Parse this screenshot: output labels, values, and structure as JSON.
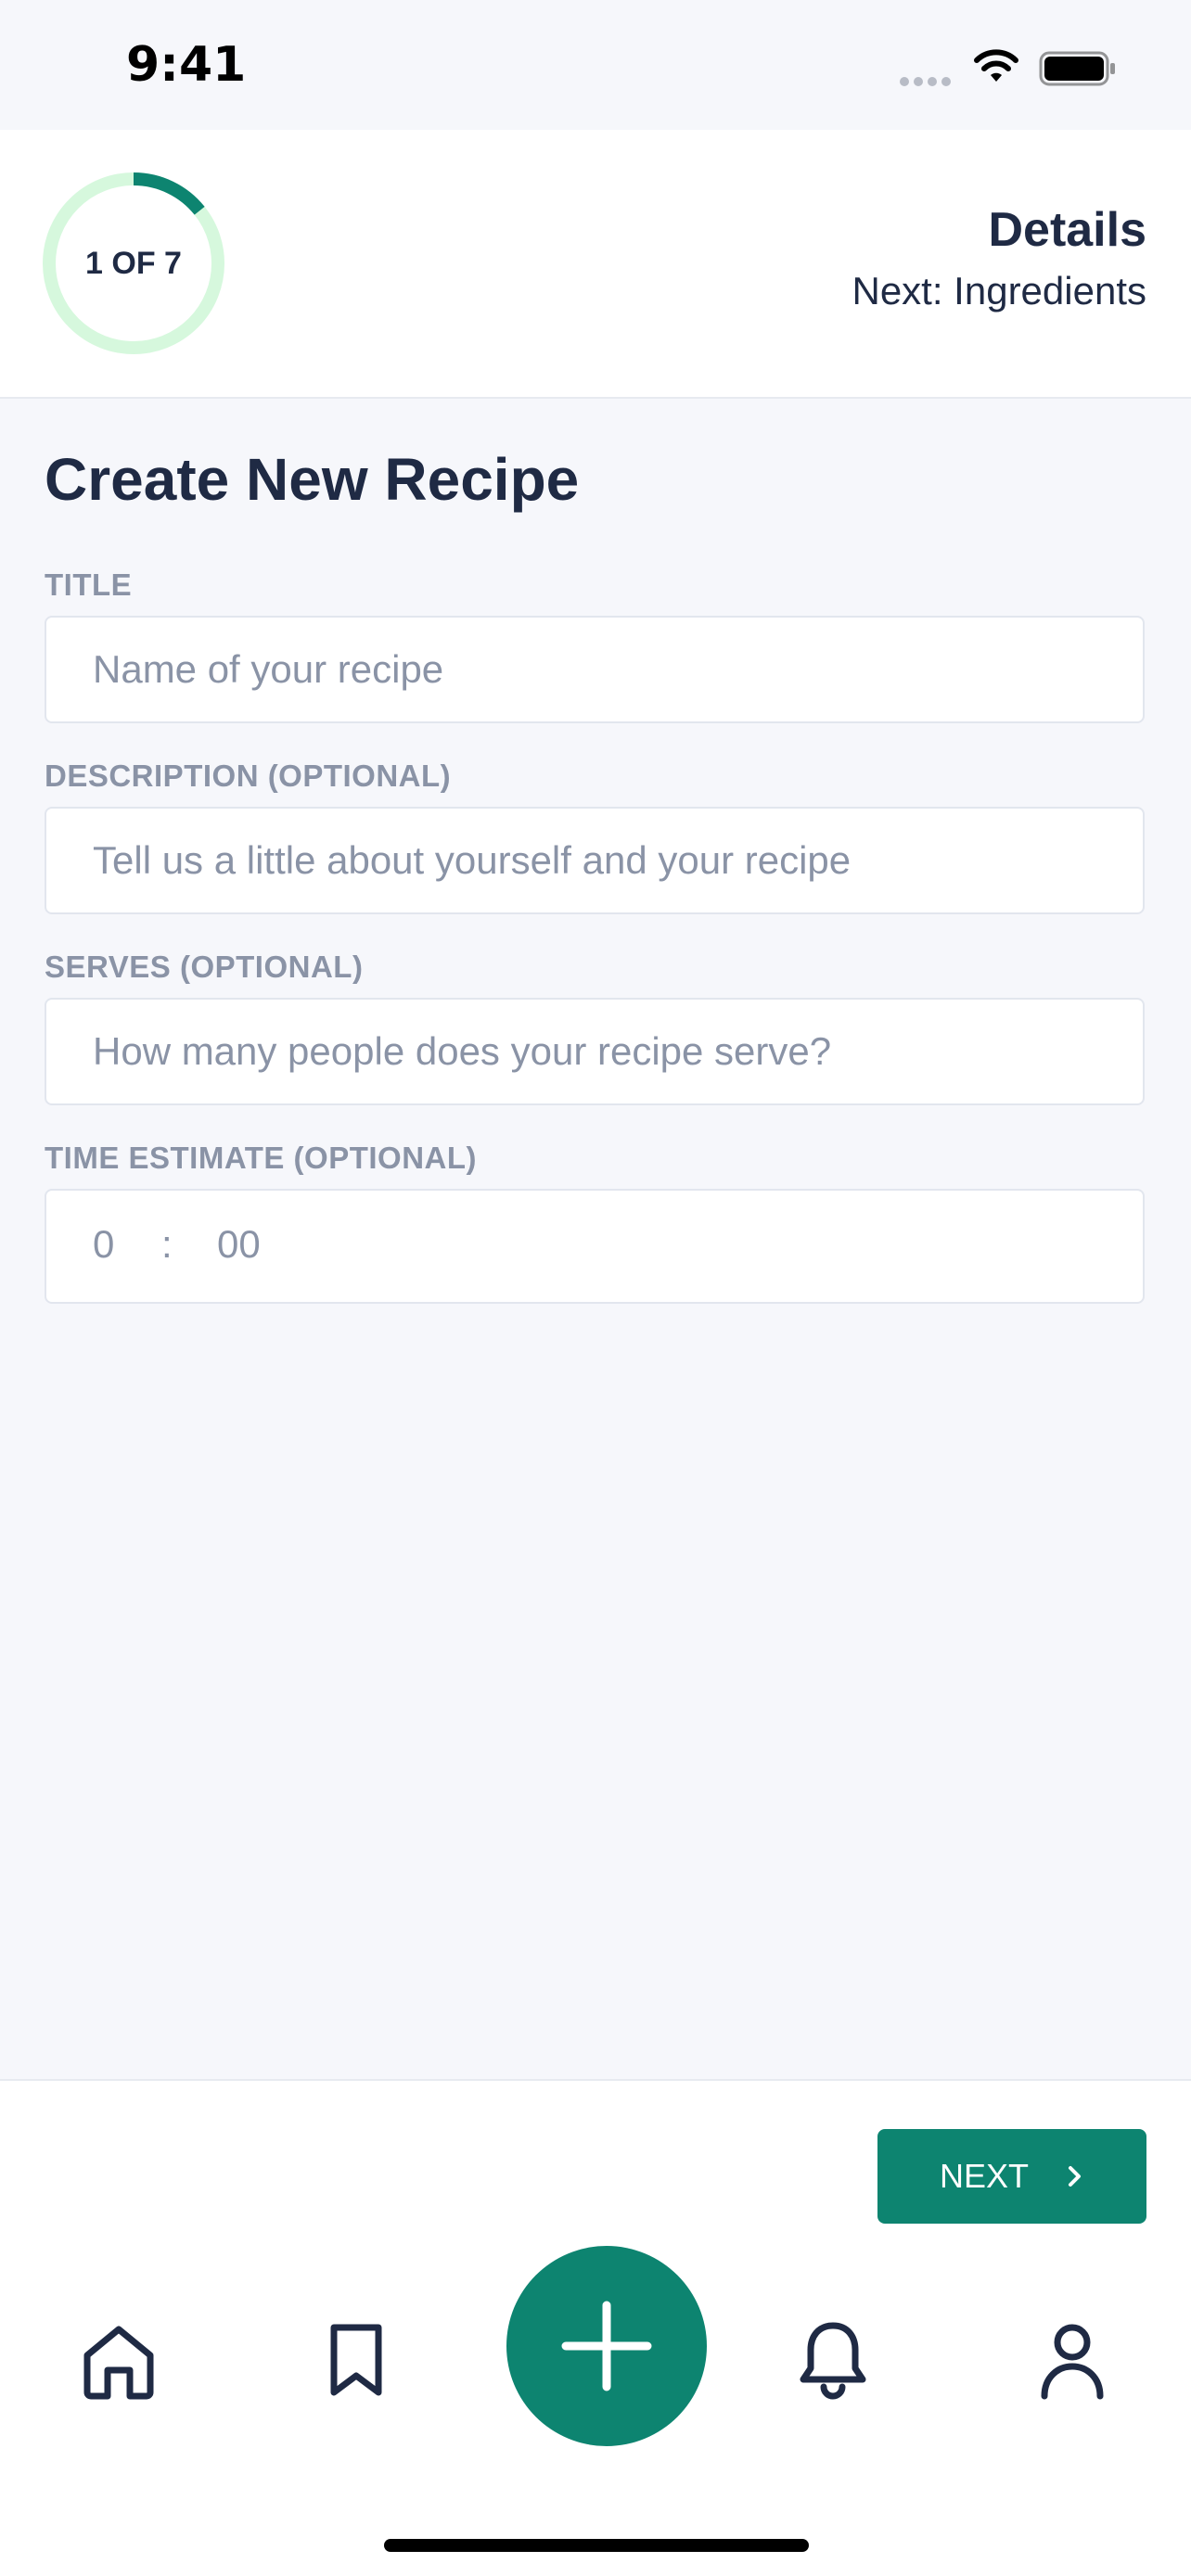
{
  "status_bar": {
    "time": "9:41",
    "icons": [
      "signal-icon",
      "wifi-icon",
      "battery-icon"
    ]
  },
  "header": {
    "progress_label": "1 OF 7",
    "progress": {
      "current": 1,
      "total": 7
    },
    "step_title": "Details",
    "next_step": "Next: Ingredients"
  },
  "form": {
    "title": "Create New Recipe",
    "fields": [
      {
        "label": "TITLE",
        "placeholder": "Name of your recipe",
        "value": ""
      },
      {
        "label": "DESCRIPTION (OPTIONAL)",
        "placeholder": "Tell us a little about yourself and your recipe",
        "value": ""
      },
      {
        "label": "SERVES (OPTIONAL)",
        "placeholder": "How many people does your recipe serve?",
        "value": ""
      }
    ],
    "time_estimate": {
      "label": "TIME ESTIMATE (OPTIONAL)",
      "hours": "0",
      "separator": ":",
      "minutes": "00"
    }
  },
  "actions": {
    "next_label": "NEXT",
    "next_icon": "chevron-right-icon"
  },
  "tab_bar": {
    "items": [
      "home-icon",
      "bookmark-icon",
      "add-icon",
      "bell-icon",
      "profile-icon"
    ]
  },
  "colors": {
    "accent": "#0d8470",
    "progress_track": "#d6f8dd",
    "text_primary": "#1f2a44",
    "text_muted": "#8a93a6",
    "background": "#f6f7fb"
  }
}
